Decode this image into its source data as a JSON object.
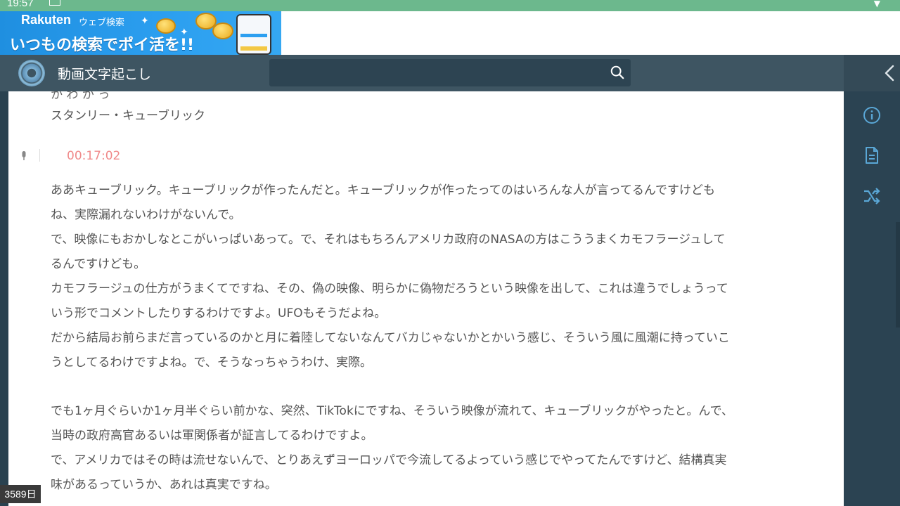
{
  "status_bar": {
    "time": "19:57"
  },
  "ad": {
    "brand": "Rakuten",
    "brand_sub": "ウェブ検索",
    "tagline": "いつもの検索でポイ活を!!"
  },
  "app_bar": {
    "title": "動画文字起こし",
    "search_icon": "search-icon",
    "back_icon": "chevron-left-icon"
  },
  "transcript": {
    "cut_line": "か わ か っ",
    "speaker": "スタンリー・キューブリック",
    "timestamp": "00:17:02",
    "lines": [
      "ああキューブリック。キューブリックが作ったんだと。キューブリックが作ったってのはいろんな人が言ってるんですけども",
      "ね、実際漏れないわけがないんで。",
      "で、映像にもおかしなとこがいっぱいあって。で、それはもちろんアメリカ政府のNASAの方はこううまくカモフラージュして",
      "るんですけども。",
      "カモフラージュの仕方がうまくてですね、その、偽の映像、明らかに偽物だろうという映像を出して、これは違うでしょうって",
      "いう形でコメントしたりするわけですよ。UFOもそうだよね。",
      "だから結局お前らまだ言っているのかと月に着陸してないなんてバカじゃないかとかいう感じ、そういう風に風潮に持っていこ",
      "うとしてるわけですよね。で、そうなっちゃうわけ、実際。",
      "",
      "でも1ヶ月ぐらいか1ヶ月半ぐらい前かな、突然、TikTokにですね、そういう映像が流れて、キューブリックがやったと。んで、",
      "当時の政府高官あるいは軍関係者が証言してるわけですよ。",
      "で、アメリカではその時は流せないんで、とりあえずヨーロッパで今流してるよっていう感じでやってたんですけど、結構真実",
      "味があるっていうか、あれは真実ですね。"
    ]
  },
  "right_rail": {
    "icons": [
      "info-icon",
      "document-icon",
      "shuffle-icon"
    ]
  },
  "badge": {
    "days": "3589日"
  },
  "colors": {
    "status_green": "#6cb88d",
    "appbar": "#3e5562",
    "rail": "#2b4352",
    "timestamp": "#f08a8a",
    "text": "#555555"
  }
}
